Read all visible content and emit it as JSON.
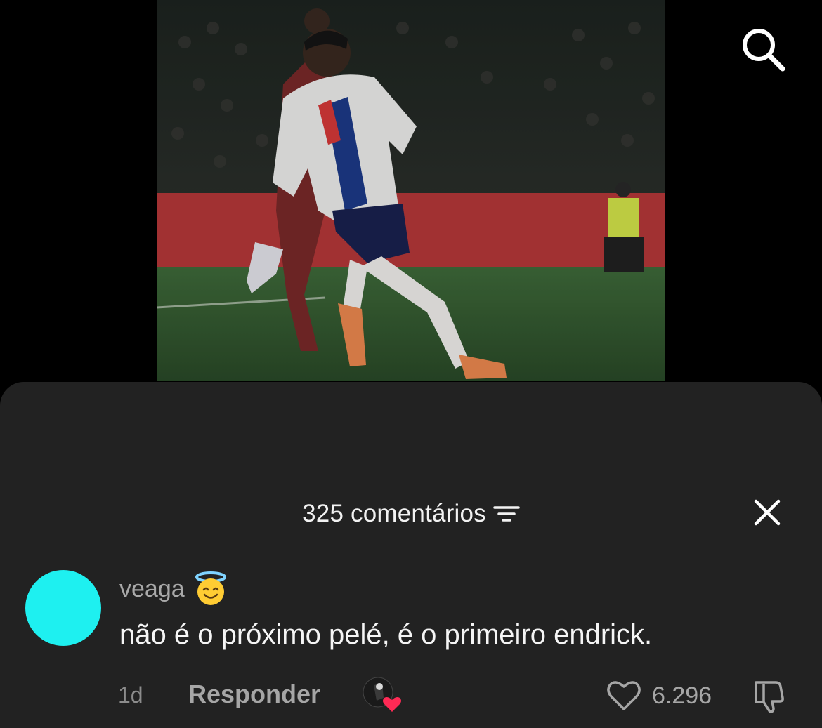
{
  "header": {
    "search_icon": "search-icon"
  },
  "comments_sheet": {
    "count_label": "325 comentários",
    "filter_icon": "filter-icon",
    "close_icon": "close-icon"
  },
  "comment": {
    "avatar_color": "#1ef0f0",
    "username": "veaga",
    "username_emoji": "smiling-face-with-halo",
    "text": "não é o próximo pelé, é o primeiro endrick.",
    "time": "1d",
    "reply_label": "Responder",
    "like_count": "6.296"
  },
  "colors": {
    "sheet_bg": "#222222",
    "muted_text": "#a6a6a6",
    "heart_red": "#ff2a55"
  }
}
